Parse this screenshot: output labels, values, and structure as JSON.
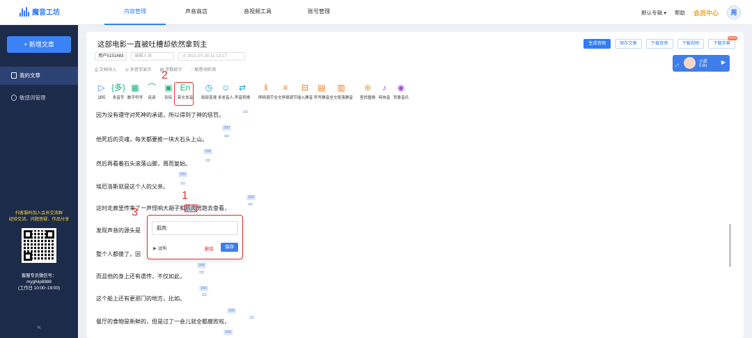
{
  "app": {
    "logo_text": "魔音工坊"
  },
  "nav": {
    "items": [
      {
        "label": "内容管理",
        "active": true
      },
      {
        "label": "声音商店"
      },
      {
        "label": "音视频工具"
      },
      {
        "label": "账号管理"
      }
    ]
  },
  "topright": {
    "album": "默认专辑",
    "help": "帮助",
    "vip": "会员中心",
    "avatar": "周"
  },
  "sidebar": {
    "new_button": "+ 新增文章",
    "items": [
      {
        "label": "我的文章",
        "active": true
      },
      {
        "label": "敏感词管理"
      }
    ],
    "promo_line1": "扫客服码加入会员交流群",
    "promo_line2": "经验交流、问题答疑、作品分享",
    "service_line1": "客服专员微信号：",
    "service_line2": "mygfvip8888",
    "service_line3": "(工作日 10:00~19:00)",
    "collapse": "«"
  },
  "doc": {
    "title": "这部电影一直被吐槽却依然拿到主",
    "user_chip": "用户5151483",
    "editor_placeholder": "编辑人员",
    "date": "2021-07-30 11:13:17",
    "subtools": [
      "文档导入",
      "多音字显示",
      "字数统计",
      "敏感词检测"
    ]
  },
  "actions": {
    "generate": "生成音频",
    "save_doc": "保存文章",
    "download_audio": "下载音频",
    "download_video": "下载视频",
    "download_subtitle": "下载字幕",
    "new_badge": "NEW"
  },
  "voice": {
    "name": "小蕊",
    "speed": "0.9x"
  },
  "toolbar": [
    {
      "label": "试听",
      "icon": "▷",
      "color": "#2f7cf6"
    },
    {
      "label": "多音字",
      "icon": "{多}",
      "color": "#19b27b"
    },
    {
      "label": "数字符号",
      "icon": "▦",
      "color": "#19b27b"
    },
    {
      "label": "连读",
      "icon": "⌒",
      "color": "#19b27b"
    },
    {
      "label": "别名",
      "icon": "▣",
      "color": "#19b27b"
    },
    {
      "label": "英文发音",
      "icon": "En",
      "color": "#19b27b"
    },
    {
      "label": "局部变速",
      "icon": "◷",
      "color": "#1aa0c8"
    },
    {
      "label": "多发音人",
      "icon": "☺",
      "color": "#1aa0c8"
    },
    {
      "label": "声音转换",
      "icon": "⇄",
      "color": "#1aa0c8"
    },
    {
      "label": "停顿调节",
      "icon": "‖",
      "color": "#f07a1e"
    },
    {
      "label": "全文停顿调节",
      "icon": "≡",
      "color": "#f07a1e"
    },
    {
      "label": "插入静音",
      "icon": "⊟",
      "color": "#f07a1e"
    },
    {
      "label": "符号静音",
      "icon": "▤",
      "color": "#f07a1e"
    },
    {
      "label": "全文段落静音",
      "icon": "▥",
      "color": "#f07a1e"
    },
    {
      "label": "查找替换",
      "icon": "⊕",
      "color": "#f0a020"
    },
    {
      "label": "特效音",
      "icon": "♪",
      "color": "#9b4dd6"
    },
    {
      "label": "背景音乐",
      "icon": "◉",
      "color": "#9b4dd6"
    }
  ],
  "annotations": {
    "n1": "1",
    "n2": "2",
    "n3": "3"
  },
  "content": {
    "pause": "200",
    "paragraphs": [
      "因为没有遵守对死神的承诺，所以得到了神的惩罚。",
      "他死后的灵魂，每天都要推一块大石头上山。",
      "然后再看着石头滚落山脚，周而复始。",
      "埃厄洛斯就是这个人的父亲。",
      "这时走廊里传来了一声怪响大胡子和",
      "发现声音的源头是",
      "整个人都傻了，因",
      "而且他的身上还有遗传，不仅如此，",
      "这个船上还有更邪门的地方，比如。",
      "餐厅的食物是新鲜的，但是过了一会儿就全都腐败啦，"
    ],
    "highlight": "肌肉",
    "after_highlight": "男跑去查看，"
  },
  "popup": {
    "value": "肌肉",
    "listen": "试听",
    "delete": "删除",
    "save": "保存"
  }
}
